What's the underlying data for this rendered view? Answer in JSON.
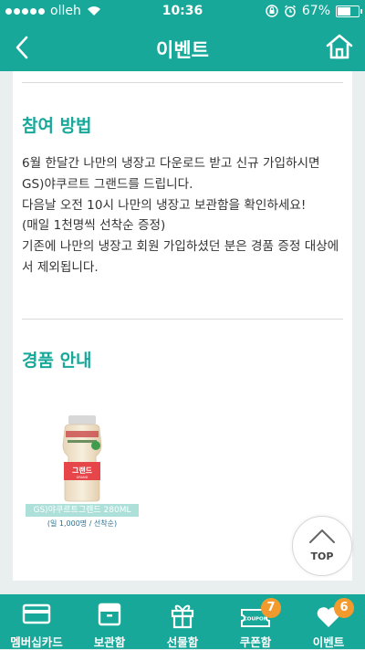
{
  "status_bar": {
    "carrier": "olleh",
    "time": "10:36",
    "battery": "67%",
    "battery_level": 0.67
  },
  "header": {
    "title": "이벤트",
    "back_icon": "chevron-left-icon",
    "home_icon": "home-icon"
  },
  "section_how": {
    "title": "참여 방법",
    "lines": [
      "6월 한달간 나만의 냉장고 다운로드 받고 신규 가입하시면",
      "GS)야쿠르트 그랜드를 드립니다.",
      "다음날 오전 10시 나만의 냉장고 보관함을 확인하세요!",
      "(매일 1천명씩 선착순 증정)",
      "기존에 나만의 냉장고 회원 가입하셨던 분은 경품 증정 대상에서 제외됩니다."
    ]
  },
  "section_prize": {
    "title": "경품 안내",
    "product_name": "GS)야쿠르트그랜드 280ML",
    "product_note": "(일 1,000명 / 선착순)",
    "bottle_label": "그랜드",
    "bottle_label_sub": "GRAND"
  },
  "top_button": {
    "label": "TOP"
  },
  "tabs": [
    {
      "label": "멤버십카드",
      "icon": "membership-card-icon"
    },
    {
      "label": "보관함",
      "icon": "storage-box-icon"
    },
    {
      "label": "선물함",
      "icon": "gift-icon"
    },
    {
      "label": "쿠폰함",
      "icon": "coupon-icon",
      "badge": "7",
      "icon_text": "COUPON"
    },
    {
      "label": "이벤트",
      "icon": "heart-icon",
      "badge": "6"
    }
  ],
  "colors": {
    "brand": "#17a89a",
    "badge": "#f29a2e",
    "background": "#e9eeee"
  }
}
